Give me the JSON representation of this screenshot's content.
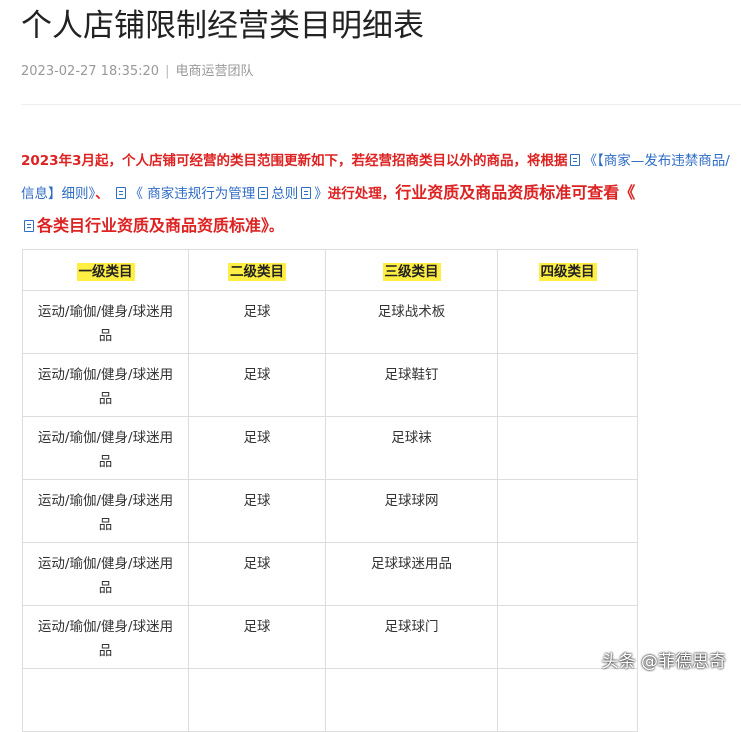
{
  "article": {
    "title": "个人店铺限制经营类目明细表",
    "date": "2023-02-27 18:35:20",
    "separator": "|",
    "author": "电商运营团队"
  },
  "intro": {
    "part1": "2023年3月起，个人店铺可经营的类目范围更新如下，若经营招商类目以外的商品，将根据",
    "link1": "《【商家—发布违禁商品/信息】细则》",
    "comma": "、",
    "link2a": "《 商家违规行为管理",
    "link2b": "总则",
    "link2c": "》",
    "part2": "进行处理，",
    "part3": "行业资质及商品资质标准可查看",
    "link3a": "《",
    "link3b": "各类目行业资质及商品资质标准》",
    "end": "。"
  },
  "table": {
    "headers": [
      "一级类目",
      "二级类目",
      "三级类目",
      "四级类目"
    ],
    "rows": [
      [
        "运动/瑜伽/健身/球迷用品",
        "足球",
        "足球战术板",
        ""
      ],
      [
        "运动/瑜伽/健身/球迷用品",
        "足球",
        "足球鞋钉",
        ""
      ],
      [
        "运动/瑜伽/健身/球迷用品",
        "足球",
        "足球袜",
        ""
      ],
      [
        "运动/瑜伽/健身/球迷用品",
        "足球",
        "足球球网",
        ""
      ],
      [
        "运动/瑜伽/健身/球迷用品",
        "足球",
        "足球球迷用品",
        ""
      ],
      [
        "运动/瑜伽/健身/球迷用品",
        "足球",
        "足球球门",
        ""
      ],
      [
        "",
        "",
        "",
        ""
      ]
    ]
  },
  "watermark": "头条 @菲德思奇",
  "icons": {
    "doc": "document-icon"
  },
  "colors": {
    "highlight_red": "#d22",
    "link_blue": "#2f6cc5",
    "header_highlight": "#ffee44"
  }
}
